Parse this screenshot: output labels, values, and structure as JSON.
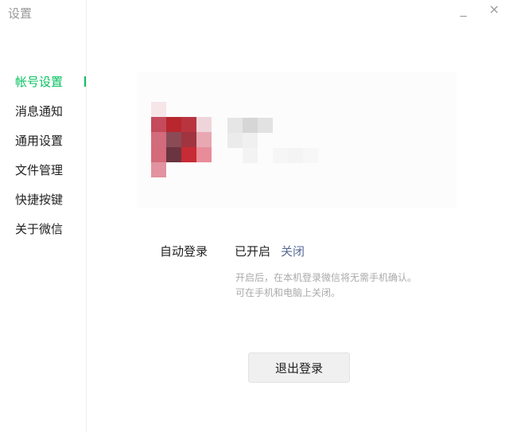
{
  "window": {
    "title": "设置",
    "minimize_glyph": "_",
    "close_glyph": "×"
  },
  "sidebar": {
    "items": [
      {
        "label": "帐号设置",
        "active": true
      },
      {
        "label": "消息通知",
        "active": false
      },
      {
        "label": "通用设置",
        "active": false
      },
      {
        "label": "文件管理",
        "active": false
      },
      {
        "label": "快捷按键",
        "active": false
      },
      {
        "label": "关于微信",
        "active": false
      }
    ]
  },
  "account": {
    "avatar_icon": "blurred-avatar-icon",
    "auto_login_label": "自动登录",
    "auto_login_status": "已开启",
    "auto_login_toggle": "关闭",
    "hint_line1": "开启后，在本机登录微信将无需手机确认。",
    "hint_line2": "可在手机和电脑上关闭。",
    "logout_label": "退出登录"
  },
  "colors": {
    "accent": "#07c160",
    "link": "#576b95",
    "hint": "#aaaaaa"
  }
}
